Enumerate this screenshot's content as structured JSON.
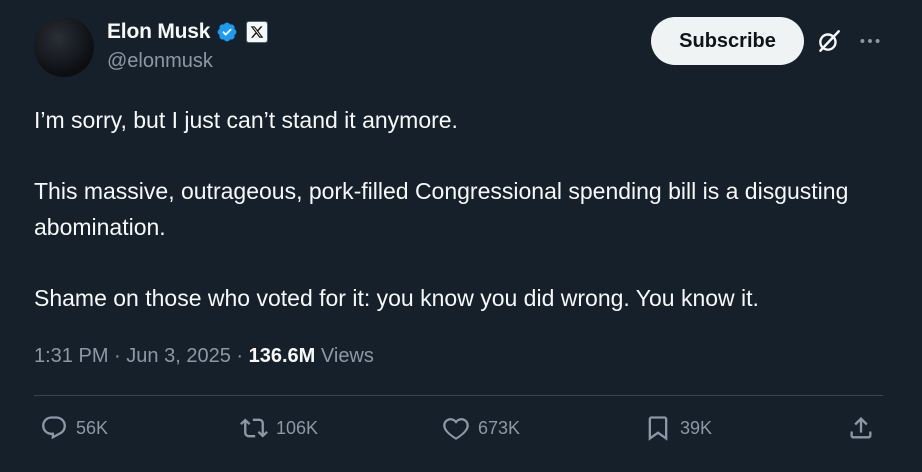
{
  "author": {
    "name": "Elon Musk",
    "handle": "@elonmusk",
    "avatar_icon": "avatar-image",
    "verified_icon": "verified-badge-icon",
    "affiliation_icon": "x-logo-icon"
  },
  "header": {
    "subscribe_label": "Subscribe",
    "grok_icon": "grok-icon",
    "more_icon": "more-icon"
  },
  "tweet": {
    "paragraphs": [
      "I’m sorry, but I just can’t stand it anymore.",
      "This massive, outrageous, pork-filled Congressional spending bill is a disgusting abomination.",
      "Shame on those who voted for it: you know you did wrong. You know it."
    ],
    "time": "1:31 PM",
    "date": "Jun 3, 2025",
    "views_count": "136.6M",
    "views_label": "Views",
    "separator": "·"
  },
  "actions": {
    "replies": "56K",
    "reposts": "106K",
    "likes": "673K",
    "bookmarks": "39K"
  },
  "colors": {
    "background": "#15202b",
    "verified": "#1d9bf0",
    "muted": "#8b98a5"
  }
}
